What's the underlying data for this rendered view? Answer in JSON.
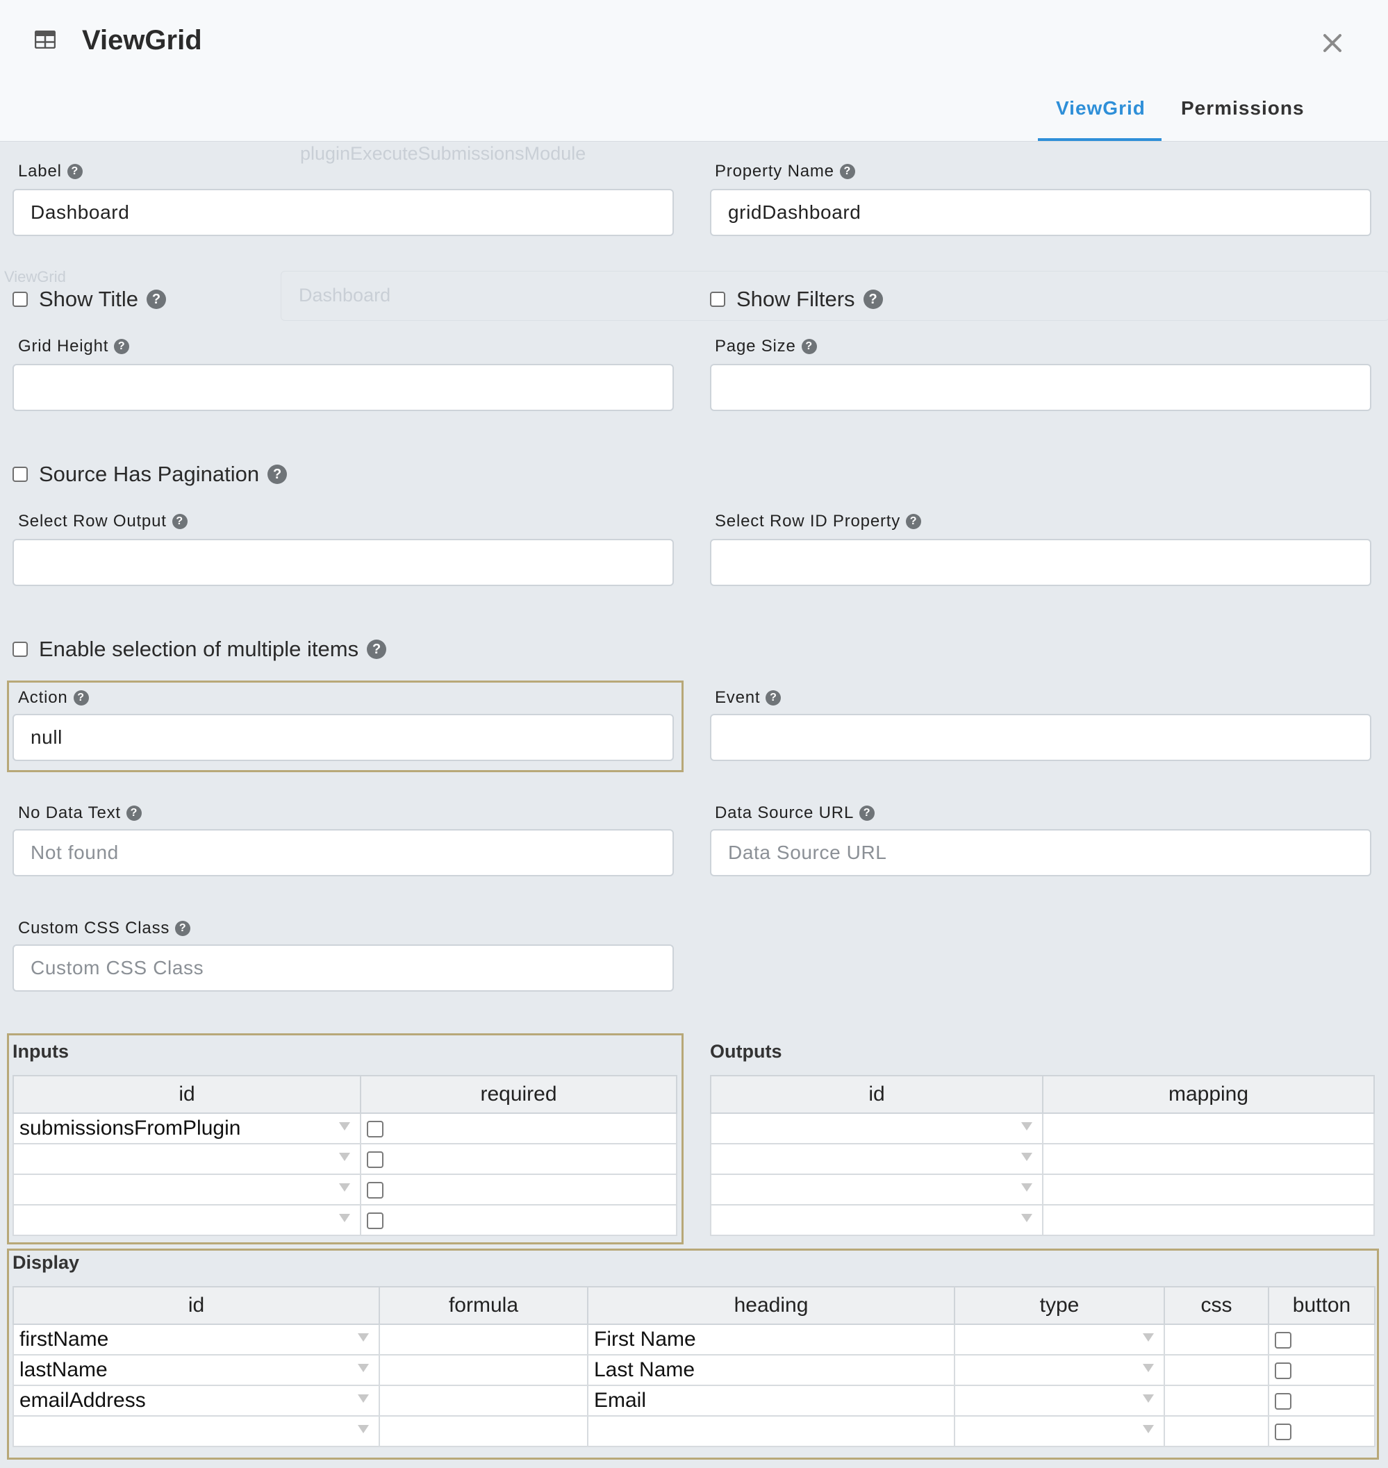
{
  "dialog": {
    "title": "ViewGrid",
    "close_icon": "close-icon",
    "header_icon": "table-icon",
    "tabs": [
      {
        "label": "ViewGrid",
        "active": true
      },
      {
        "label": "Permissions",
        "active": false
      }
    ]
  },
  "background": {
    "item1": "pluginExecuteSubmissionsModule",
    "item2": "Dashboard",
    "item3": "ViewGrid"
  },
  "fields": {
    "label": {
      "label": "Label",
      "value": "Dashboard"
    },
    "property_name": {
      "label": "Property Name",
      "value": "gridDashboard"
    },
    "show_title": {
      "label": "Show Title",
      "checked": false
    },
    "show_filters": {
      "label": "Show Filters",
      "checked": false
    },
    "grid_height": {
      "label": "Grid Height",
      "value": ""
    },
    "page_size": {
      "label": "Page Size",
      "value": ""
    },
    "source_has_pagination": {
      "label": "Source Has Pagination",
      "checked": false
    },
    "select_row_output": {
      "label": "Select Row Output",
      "value": ""
    },
    "select_row_id_property": {
      "label": "Select Row ID Property",
      "value": ""
    },
    "enable_multi_select": {
      "label": "Enable selection of multiple items",
      "checked": false
    },
    "action": {
      "label": "Action",
      "value": "null"
    },
    "event": {
      "label": "Event",
      "value": ""
    },
    "no_data_text": {
      "label": "No Data Text",
      "placeholder": "Not found"
    },
    "data_source_url": {
      "label": "Data Source URL",
      "placeholder": "Data Source URL"
    },
    "custom_css_class": {
      "label": "Custom CSS Class",
      "placeholder": "Custom CSS Class"
    }
  },
  "inputs": {
    "title": "Inputs",
    "headers": [
      "id",
      "required"
    ],
    "rows": [
      {
        "id": "submissionsFromPlugin",
        "required": false
      },
      {
        "id": "",
        "required": false
      },
      {
        "id": "",
        "required": false
      },
      {
        "id": "",
        "required": false
      }
    ]
  },
  "outputs": {
    "title": "Outputs",
    "headers": [
      "id",
      "mapping"
    ],
    "rows": [
      {
        "id": "",
        "mapping": ""
      },
      {
        "id": "",
        "mapping": ""
      },
      {
        "id": "",
        "mapping": ""
      },
      {
        "id": "",
        "mapping": ""
      }
    ]
  },
  "display": {
    "title": "Display",
    "headers": [
      "id",
      "formula",
      "heading",
      "type",
      "css",
      "button"
    ],
    "rows": [
      {
        "id": "firstName",
        "formula": "",
        "heading": "First Name",
        "type": "",
        "css": "",
        "button": false
      },
      {
        "id": "lastName",
        "formula": "",
        "heading": "Last Name",
        "type": "",
        "css": "",
        "button": false
      },
      {
        "id": "emailAddress",
        "formula": "",
        "heading": "Email",
        "type": "",
        "css": "",
        "button": false
      },
      {
        "id": "",
        "formula": "",
        "heading": "",
        "type": "",
        "css": "",
        "button": false
      }
    ]
  },
  "help_icon": "question-circle-icon"
}
